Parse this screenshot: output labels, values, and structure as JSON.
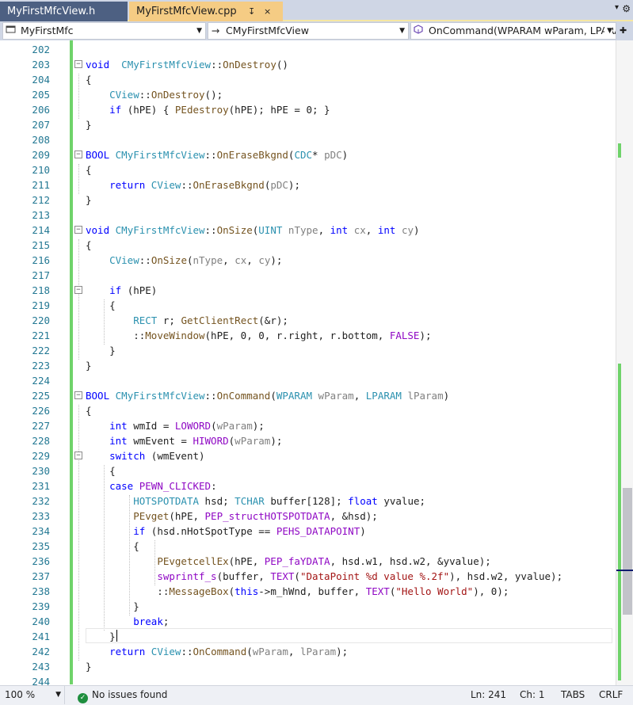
{
  "tabs": [
    {
      "label": "MyFirstMfcView.h",
      "active": false
    },
    {
      "label": "MyFirstMfcView.cpp",
      "active": true,
      "controls": [
        "↧",
        "×"
      ]
    }
  ],
  "tab_controls": {
    "overflow": "▾",
    "settings": "⚙"
  },
  "navbar": {
    "project": "MyFirstMfc",
    "class_scope": "CMyFirstMfcView",
    "member": "OnCommand(WPARAM wParam, LPARAM lParam)"
  },
  "editor": {
    "line_numbers": [
      "202",
      "203",
      "204",
      "205",
      "206",
      "207",
      "208",
      "209",
      "210",
      "211",
      "212",
      "213",
      "214",
      "215",
      "216",
      "217",
      "218",
      "219",
      "220",
      "221",
      "222",
      "223",
      "224",
      "225",
      "226",
      "227",
      "228",
      "229",
      "230",
      "231",
      "232",
      "233",
      "234",
      "235",
      "236",
      "237",
      "238",
      "239",
      "240",
      "241",
      "242",
      "243",
      "244"
    ],
    "lines": [
      [],
      [
        [
          "kw",
          "void"
        ],
        [
          "",
          "  "
        ],
        [
          "ty",
          "CMyFirstMfcView"
        ],
        [
          "",
          "::"
        ],
        [
          "fn",
          "OnDestroy"
        ],
        [
          "",
          "()"
        ]
      ],
      [
        [
          "",
          "{"
        ]
      ],
      [
        [
          "",
          "    "
        ],
        [
          "ty",
          "CView"
        ],
        [
          "",
          "::"
        ],
        [
          "fn",
          "OnDestroy"
        ],
        [
          "",
          "();"
        ]
      ],
      [
        [
          "",
          "    "
        ],
        [
          "kw",
          "if"
        ],
        [
          "",
          " (hPE) { "
        ],
        [
          "fn",
          "PEdestroy"
        ],
        [
          "",
          "(hPE); hPE = 0; }"
        ]
      ],
      [
        [
          "",
          "}"
        ]
      ],
      [],
      [
        [
          "kw",
          "BOOL"
        ],
        [
          "",
          " "
        ],
        [
          "ty",
          "CMyFirstMfcView"
        ],
        [
          "",
          "::"
        ],
        [
          "fn",
          "OnEraseBkgnd"
        ],
        [
          "",
          "("
        ],
        [
          "ty",
          "CDC"
        ],
        [
          "",
          "* "
        ],
        [
          "pm",
          "pDC"
        ],
        [
          "",
          ")"
        ]
      ],
      [
        [
          "",
          "{"
        ]
      ],
      [
        [
          "",
          "    "
        ],
        [
          "kw",
          "return"
        ],
        [
          "",
          " "
        ],
        [
          "ty",
          "CView"
        ],
        [
          "",
          "::"
        ],
        [
          "fn",
          "OnEraseBkgnd"
        ],
        [
          "",
          "("
        ],
        [
          "pm",
          "pDC"
        ],
        [
          "",
          ");"
        ]
      ],
      [
        [
          "",
          "}"
        ]
      ],
      [],
      [
        [
          "kw",
          "void"
        ],
        [
          "",
          " "
        ],
        [
          "ty",
          "CMyFirstMfcView"
        ],
        [
          "",
          "::"
        ],
        [
          "fn",
          "OnSize"
        ],
        [
          "",
          "("
        ],
        [
          "ty",
          "UINT"
        ],
        [
          "",
          " "
        ],
        [
          "pm",
          "nType"
        ],
        [
          "",
          ", "
        ],
        [
          "kw",
          "int"
        ],
        [
          "",
          " "
        ],
        [
          "pm",
          "cx"
        ],
        [
          "",
          ", "
        ],
        [
          "kw",
          "int"
        ],
        [
          "",
          " "
        ],
        [
          "pm",
          "cy"
        ],
        [
          "",
          ")"
        ]
      ],
      [
        [
          "",
          "{"
        ]
      ],
      [
        [
          "",
          "    "
        ],
        [
          "ty",
          "CView"
        ],
        [
          "",
          "::"
        ],
        [
          "fn",
          "OnSize"
        ],
        [
          "",
          "("
        ],
        [
          "pm",
          "nType"
        ],
        [
          "",
          ", "
        ],
        [
          "pm",
          "cx"
        ],
        [
          "",
          ", "
        ],
        [
          "pm",
          "cy"
        ],
        [
          "",
          ");"
        ]
      ],
      [],
      [
        [
          "",
          "    "
        ],
        [
          "kw",
          "if"
        ],
        [
          "",
          " (hPE)"
        ]
      ],
      [
        [
          "",
          "    {"
        ]
      ],
      [
        [
          "",
          "        "
        ],
        [
          "ty",
          "RECT"
        ],
        [
          "",
          " r; "
        ],
        [
          "fn",
          "GetClientRect"
        ],
        [
          "",
          "(&r);"
        ]
      ],
      [
        [
          "",
          "        ::"
        ],
        [
          "fn",
          "MoveWindow"
        ],
        [
          "",
          "(hPE, 0, 0, r.right, r.bottom, "
        ],
        [
          "mc",
          "FALSE"
        ],
        [
          "",
          ");"
        ]
      ],
      [
        [
          "",
          "    }"
        ]
      ],
      [
        [
          "",
          "}"
        ]
      ],
      [],
      [
        [
          "kw",
          "BOOL"
        ],
        [
          "",
          " "
        ],
        [
          "ty",
          "CMyFirstMfcView"
        ],
        [
          "",
          "::"
        ],
        [
          "fn",
          "OnCommand"
        ],
        [
          "",
          "("
        ],
        [
          "ty",
          "WPARAM"
        ],
        [
          "",
          " "
        ],
        [
          "pm",
          "wParam"
        ],
        [
          "",
          ", "
        ],
        [
          "ty",
          "LPARAM"
        ],
        [
          "",
          " "
        ],
        [
          "pm",
          "lParam"
        ],
        [
          "",
          ")"
        ]
      ],
      [
        [
          "",
          "{"
        ]
      ],
      [
        [
          "",
          "    "
        ],
        [
          "kw",
          "int"
        ],
        [
          "",
          " wmId = "
        ],
        [
          "mc",
          "LOWORD"
        ],
        [
          "",
          "("
        ],
        [
          "pm",
          "wParam"
        ],
        [
          "",
          ");"
        ]
      ],
      [
        [
          "",
          "    "
        ],
        [
          "kw",
          "int"
        ],
        [
          "",
          " wmEvent = "
        ],
        [
          "mc",
          "HIWORD"
        ],
        [
          "",
          "("
        ],
        [
          "pm",
          "wParam"
        ],
        [
          "",
          ");"
        ]
      ],
      [
        [
          "",
          "    "
        ],
        [
          "kw",
          "switch"
        ],
        [
          "",
          " (wmEvent)"
        ]
      ],
      [
        [
          "",
          "    {"
        ]
      ],
      [
        [
          "",
          "    "
        ],
        [
          "kw",
          "case"
        ],
        [
          "",
          " "
        ],
        [
          "mc",
          "PEWN_CLICKED"
        ],
        [
          "",
          ":"
        ]
      ],
      [
        [
          "",
          "        "
        ],
        [
          "ty",
          "HOTSPOTDATA"
        ],
        [
          "",
          " hsd; "
        ],
        [
          "ty",
          "TCHAR"
        ],
        [
          "",
          " buffer[128]; "
        ],
        [
          "kw",
          "float"
        ],
        [
          "",
          " yvalue;"
        ]
      ],
      [
        [
          "",
          "        "
        ],
        [
          "fn",
          "PEvget"
        ],
        [
          "",
          "(hPE, "
        ],
        [
          "mc",
          "PEP_structHOTSPOTDATA"
        ],
        [
          "",
          ", &hsd);"
        ]
      ],
      [
        [
          "",
          "        "
        ],
        [
          "kw",
          "if"
        ],
        [
          "",
          " (hsd.nHotSpotType == "
        ],
        [
          "mc",
          "PEHS_DATAPOINT"
        ],
        [
          "",
          ")"
        ]
      ],
      [
        [
          "",
          "        {"
        ]
      ],
      [
        [
          "",
          "            "
        ],
        [
          "fn",
          "PEvgetcellEx"
        ],
        [
          "",
          "(hPE, "
        ],
        [
          "mc",
          "PEP_faYDATA"
        ],
        [
          "",
          ", hsd.w1, hsd.w2, &yvalue);"
        ]
      ],
      [
        [
          "",
          "            "
        ],
        [
          "mc",
          "swprintf_s"
        ],
        [
          "",
          "(buffer, "
        ],
        [
          "mc",
          "TEXT"
        ],
        [
          "",
          "("
        ],
        [
          "st",
          "\"DataPoint %d value %.2f\""
        ],
        [
          "",
          "), hsd.w2, yvalue);"
        ]
      ],
      [
        [
          "",
          "            ::"
        ],
        [
          "fn",
          "MessageBox"
        ],
        [
          "",
          "("
        ],
        [
          "kw",
          "this"
        ],
        [
          "",
          "->m_hWnd, buffer, "
        ],
        [
          "mc",
          "TEXT"
        ],
        [
          "",
          "("
        ],
        [
          "st",
          "\"Hello World\""
        ],
        [
          "",
          "), 0);"
        ]
      ],
      [
        [
          "",
          "        }"
        ]
      ],
      [
        [
          "",
          "        "
        ],
        [
          "kw",
          "break"
        ],
        [
          "",
          ";"
        ]
      ],
      [
        [
          "",
          "    }"
        ]
      ],
      [
        [
          "",
          "    "
        ],
        [
          "kw",
          "return"
        ],
        [
          "",
          " "
        ],
        [
          "ty",
          "CView"
        ],
        [
          "",
          "::"
        ],
        [
          "fn",
          "OnCommand"
        ],
        [
          "",
          "("
        ],
        [
          "pm",
          "wParam"
        ],
        [
          "",
          ", "
        ],
        [
          "pm",
          "lParam"
        ],
        [
          "",
          ");"
        ]
      ],
      [
        [
          "",
          "}"
        ]
      ],
      []
    ]
  },
  "statusbar": {
    "zoom": "100 %",
    "issues": "No issues found",
    "line": "Ln: 241",
    "column": "Ch: 1",
    "indent_mode": "TABS",
    "line_endings": "CRLF"
  },
  "colors": {
    "keyword": "#0000ff",
    "type": "#2b91af",
    "function": "#74531f",
    "parameter": "#808080",
    "macro": "#8f08c4",
    "string": "#a31515",
    "active_tab": "#f5cc84",
    "inactive_tab": "#4d6082",
    "change_bar": "#6fd36a",
    "line_number": "#237893"
  }
}
